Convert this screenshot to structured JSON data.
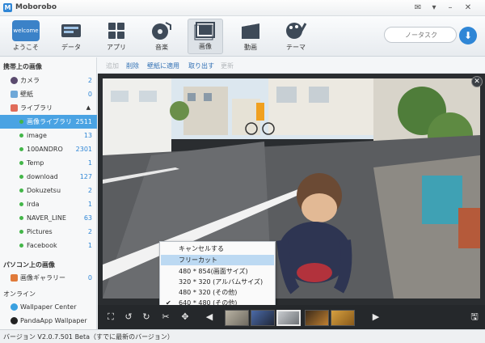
{
  "window": {
    "title": "Moborobo",
    "logo": "M",
    "controls": [
      "message-icon",
      "menu-icon",
      "minimize-icon",
      "close-icon"
    ]
  },
  "toolbar": {
    "items": [
      {
        "label": "ようこそ",
        "icon": "welcome-icon",
        "icon_text": "welcome"
      },
      {
        "label": "データ",
        "icon": "data-icon"
      },
      {
        "label": "アプリ",
        "icon": "apps-icon"
      },
      {
        "label": "音楽",
        "icon": "music-icon"
      },
      {
        "label": "画像",
        "icon": "image-icon",
        "active": true
      },
      {
        "label": "動画",
        "icon": "video-icon"
      },
      {
        "label": "テーマ",
        "icon": "theme-icon"
      }
    ],
    "search_placeholder": "ノータスク",
    "download_icon": "download-icon"
  },
  "sidebar": {
    "device_section": "携帯上の画像",
    "device_items": [
      {
        "label": "カメラ",
        "count": "2",
        "icon": "camera-icon"
      },
      {
        "label": "壁紙",
        "count": "0",
        "icon": "wallpaper-icon"
      },
      {
        "label": "ライブラリ",
        "count": "",
        "icon": "library-icon",
        "expanded": true
      }
    ],
    "library_items": [
      {
        "label": "画像ライブラリ",
        "count": "2511",
        "selected": true
      },
      {
        "label": "image",
        "count": "13"
      },
      {
        "label": "100ANDRO",
        "count": "2301"
      },
      {
        "label": "Temp",
        "count": "1"
      },
      {
        "label": "download",
        "count": "127"
      },
      {
        "label": "Dokuzetsu",
        "count": "2"
      },
      {
        "label": "Irda",
        "count": "1"
      },
      {
        "label": "NAVER_LINE",
        "count": "63"
      },
      {
        "label": "Pictures",
        "count": "2"
      },
      {
        "label": "Facebook",
        "count": "1"
      }
    ],
    "pc_section": "パソコン上の画像",
    "pc_items": [
      {
        "label": "画像ギャラリー",
        "count": "0"
      }
    ],
    "online_section": "オンライン",
    "online_items": [
      {
        "label": "Wallpaper Center",
        "icon": "globe-icon"
      },
      {
        "label": "PandaApp Wallpaper",
        "icon": "panda-icon"
      }
    ]
  },
  "actions": [
    {
      "label": "追加",
      "enabled": false
    },
    {
      "label": "削除",
      "enabled": true
    },
    {
      "label": "壁紙に適用",
      "enabled": true
    },
    {
      "label": "取り出す",
      "enabled": true
    },
    {
      "label": "更新",
      "enabled": false
    }
  ],
  "context_menu": {
    "items": [
      {
        "label": "キャンセルする",
        "checked": false,
        "highlight": false
      },
      {
        "label": "フリーカット",
        "checked": false,
        "highlight": true
      },
      {
        "label": "480 * 854(画面サイズ)",
        "checked": false,
        "highlight": false
      },
      {
        "label": "320 * 320 (アルバムサイズ)",
        "checked": false,
        "highlight": false
      },
      {
        "label": "480 * 320 (その他)",
        "checked": false,
        "highlight": false
      },
      {
        "label": "640 * 480 (その他)",
        "checked": true,
        "highlight": false
      }
    ]
  },
  "bottom_strip": {
    "tools": [
      "fit-icon",
      "rotate-left-icon",
      "rotate-right-icon",
      "crop-icon",
      "move-icon"
    ],
    "prev_icon": "prev-arrow-icon",
    "next_icon": "next-arrow-icon",
    "save_icon": "save-icon"
  },
  "status": {
    "text": "バージョン V2.0.7.501 Beta（すでに最新のバージョン）"
  },
  "colors": {
    "accent": "#4aa3e3",
    "link": "#2f6fb3",
    "brand": "#2f86d6"
  }
}
